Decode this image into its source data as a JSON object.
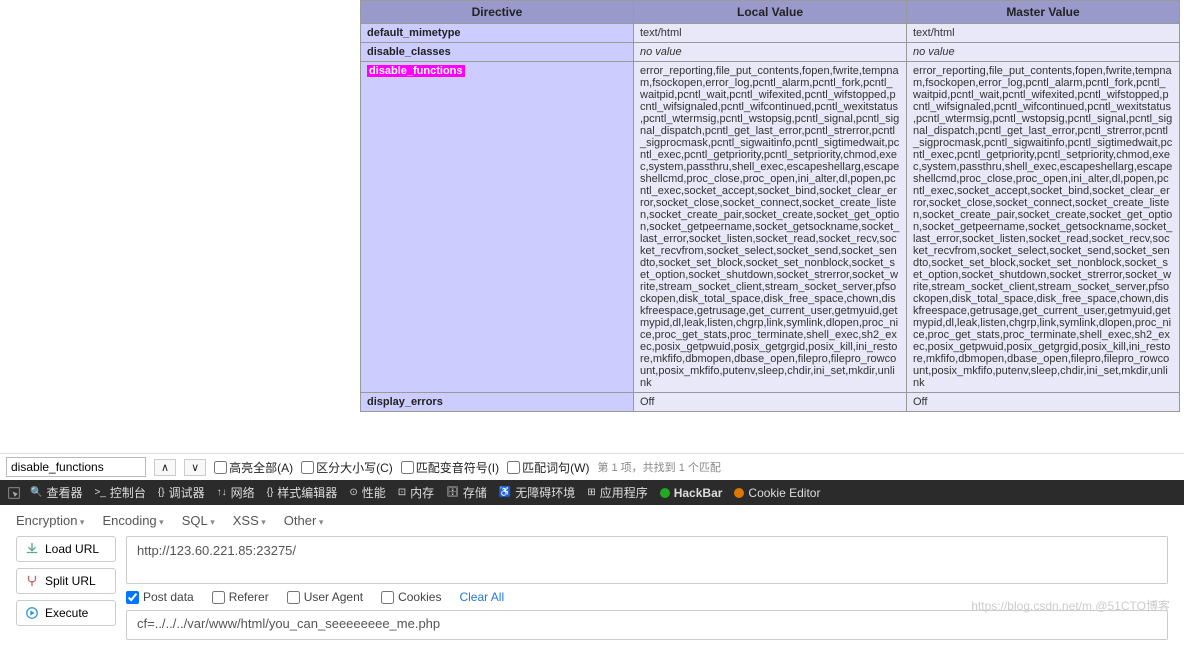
{
  "table": {
    "headers": [
      "Directive",
      "Local Value",
      "Master Value"
    ],
    "rows": [
      {
        "directive": "default_mimetype",
        "local": "text/html",
        "master": "text/html",
        "novalue": false
      },
      {
        "directive": "disable_classes",
        "local": "no value",
        "master": "no value",
        "novalue": true
      },
      {
        "directive": "disable_functions",
        "highlight": true,
        "local": "error_reporting,file_put_contents,fopen,fwrite,tempnam,fsockopen,error_log,pcntl_alarm,pcntl_fork,pcntl_waitpid,pcntl_wait,pcntl_wifexited,pcntl_wifstopped,pcntl_wifsignaled,pcntl_wifcontinued,pcntl_wexitstatus,pcntl_wtermsig,pcntl_wstopsig,pcntl_signal,pcntl_signal_dispatch,pcntl_get_last_error,pcntl_strerror,pcntl_sigprocmask,pcntl_sigwaitinfo,pcntl_sigtimedwait,pcntl_exec,pcntl_getpriority,pcntl_setpriority,chmod,exec,system,passthru,shell_exec,escapeshellarg,escapeshellcmd,proc_close,proc_open,ini_alter,dl,popen,pcntl_exec,socket_accept,socket_bind,socket_clear_error,socket_close,socket_connect,socket_create_listen,socket_create_pair,socket_create,socket_get_option,socket_getpeername,socket_getsockname,socket_last_error,socket_listen,socket_read,socket_recv,socket_recvfrom,socket_select,socket_send,socket_sendto,socket_set_block,socket_set_nonblock,socket_set_option,socket_shutdown,socket_strerror,socket_write,stream_socket_client,stream_socket_server,pfsockopen,disk_total_space,disk_free_space,chown,diskfreespace,getrusage,get_current_user,getmyuid,getmypid,dl,leak,listen,chgrp,link,symlink,dlopen,proc_nice,proc_get_stats,proc_terminate,shell_exec,sh2_exec,posix_getpwuid,posix_getgrgid,posix_kill,ini_restore,mkfifo,dbmopen,dbase_open,filepro,filepro_rowcount,posix_mkfifo,putenv,sleep,chdir,ini_set,mkdir,unlink",
        "master": "error_reporting,file_put_contents,fopen,fwrite,tempnam,fsockopen,error_log,pcntl_alarm,pcntl_fork,pcntl_waitpid,pcntl_wait,pcntl_wifexited,pcntl_wifstopped,pcntl_wifsignaled,pcntl_wifcontinued,pcntl_wexitstatus,pcntl_wtermsig,pcntl_wstopsig,pcntl_signal,pcntl_signal_dispatch,pcntl_get_last_error,pcntl_strerror,pcntl_sigprocmask,pcntl_sigwaitinfo,pcntl_sigtimedwait,pcntl_exec,pcntl_getpriority,pcntl_setpriority,chmod,exec,system,passthru,shell_exec,escapeshellarg,escapeshellcmd,proc_close,proc_open,ini_alter,dl,popen,pcntl_exec,socket_accept,socket_bind,socket_clear_error,socket_close,socket_connect,socket_create_listen,socket_create_pair,socket_create,socket_get_option,socket_getpeername,socket_getsockname,socket_last_error,socket_listen,socket_read,socket_recv,socket_recvfrom,socket_select,socket_send,socket_sendto,socket_set_block,socket_set_nonblock,socket_set_option,socket_shutdown,socket_strerror,socket_write,stream_socket_client,stream_socket_server,pfsockopen,disk_total_space,disk_free_space,chown,diskfreespace,getrusage,get_current_user,getmyuid,getmypid,dl,leak,listen,chgrp,link,symlink,dlopen,proc_nice,proc_get_stats,proc_terminate,shell_exec,sh2_exec,posix_getpwuid,posix_getgrgid,posix_kill,ini_restore,mkfifo,dbmopen,dbase_open,filepro,filepro_rowcount,posix_mkfifo,putenv,sleep,chdir,ini_set,mkdir,unlink"
      },
      {
        "directive": "display_errors",
        "local": "Off",
        "master": "Off",
        "novalue": false
      }
    ]
  },
  "findbar": {
    "query": "disable_functions",
    "highlight_all": "高亮全部(A)",
    "match_case": "区分大小写(C)",
    "match_diacritics": "匹配变音符号(I)",
    "whole_words": "匹配词句(W)",
    "status": "第 1 项，共找到 1 个匹配"
  },
  "devtools": {
    "tabs": [
      "查看器",
      "控制台",
      "调试器",
      "网络",
      "样式编辑器",
      "性能",
      "内存",
      "存储",
      "无障碍环境",
      "应用程序",
      "HackBar",
      "Cookie Editor"
    ]
  },
  "hackbar": {
    "menu": [
      "Encryption",
      "Encoding",
      "SQL",
      "XSS",
      "Other"
    ],
    "load": "Load URL",
    "split": "Split URL",
    "execute": "Execute",
    "url": "http://123.60.221.85:23275/",
    "opts": {
      "post": "Post data",
      "referer": "Referer",
      "ua": "User Agent",
      "cookies": "Cookies",
      "clear": "Clear All"
    },
    "post": "cf=../../../var/www/html/you_can_seeeeeeee_me.php"
  },
  "watermark": "https://blog.csdn.net/m @51CTO博客"
}
